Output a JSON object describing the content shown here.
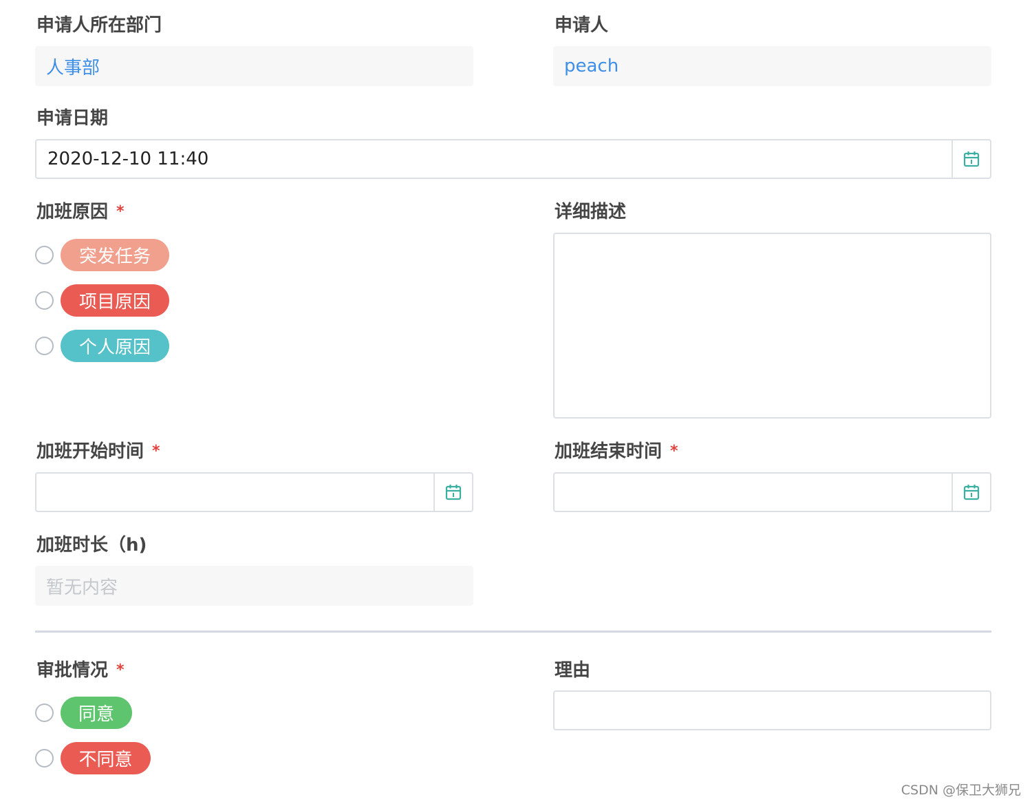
{
  "applicant_department": {
    "label": "申请人所在部门",
    "value": "人事部"
  },
  "applicant": {
    "label": "申请人",
    "value": "peach"
  },
  "apply_date": {
    "label": "申请日期",
    "value": "2020-12-10 11:40",
    "icon": "calendar-icon"
  },
  "overtime_reason": {
    "label": "加班原因",
    "required_mark": "*",
    "options": [
      {
        "label": "突发任务",
        "color": "#f2a08e"
      },
      {
        "label": "项目原因",
        "color": "#ea5b53"
      },
      {
        "label": "个人原因",
        "color": "#54c2c8"
      }
    ]
  },
  "detail_description": {
    "label": "详细描述",
    "value": ""
  },
  "overtime_start": {
    "label": "加班开始时间",
    "required_mark": "*",
    "value": "",
    "icon": "calendar-icon"
  },
  "overtime_end": {
    "label": "加班结束时间",
    "required_mark": "*",
    "value": "",
    "icon": "calendar-icon"
  },
  "overtime_duration": {
    "label": "加班时长（h)",
    "placeholder": "暂无内容"
  },
  "approval_status": {
    "label": "审批情况",
    "required_mark": "*",
    "options": [
      {
        "label": "同意",
        "color": "#5ec46e"
      },
      {
        "label": "不同意",
        "color": "#ea5b53"
      }
    ]
  },
  "reason": {
    "label": "理由",
    "value": ""
  },
  "watermark": "CSDN @保卫大狮兄",
  "colors": {
    "accent_icon": "#3bb0a0",
    "link_text": "#3f8fe8",
    "required": "#e0413b"
  }
}
